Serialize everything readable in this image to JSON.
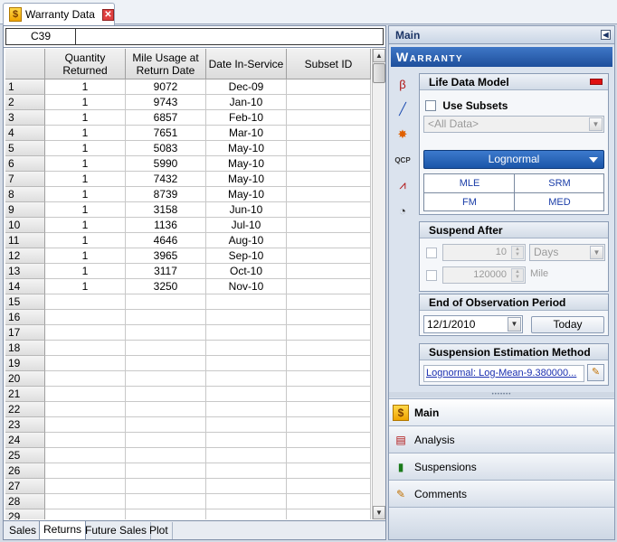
{
  "doc_tab": {
    "title": "Warranty Data",
    "icon": "dollar-icon",
    "close": "✕"
  },
  "formula": {
    "cell_ref": "C39",
    "value": ""
  },
  "columns": [
    {
      "label": "Quantity Returned"
    },
    {
      "label": "Mile Usage at Return Date"
    },
    {
      "label": "Date In-Service"
    },
    {
      "label": "Subset ID"
    }
  ],
  "rows": [
    {
      "n": "1",
      "q": "1",
      "m": "9072",
      "d": "Dec-09",
      "s": ""
    },
    {
      "n": "2",
      "q": "1",
      "m": "9743",
      "d": "Jan-10",
      "s": ""
    },
    {
      "n": "3",
      "q": "1",
      "m": "6857",
      "d": "Feb-10",
      "s": ""
    },
    {
      "n": "4",
      "q": "1",
      "m": "7651",
      "d": "Mar-10",
      "s": ""
    },
    {
      "n": "5",
      "q": "1",
      "m": "5083",
      "d": "May-10",
      "s": ""
    },
    {
      "n": "6",
      "q": "1",
      "m": "5990",
      "d": "May-10",
      "s": ""
    },
    {
      "n": "7",
      "q": "1",
      "m": "7432",
      "d": "May-10",
      "s": ""
    },
    {
      "n": "8",
      "q": "1",
      "m": "8739",
      "d": "May-10",
      "s": ""
    },
    {
      "n": "9",
      "q": "1",
      "m": "3158",
      "d": "Jun-10",
      "s": ""
    },
    {
      "n": "10",
      "q": "1",
      "m": "1136",
      "d": "Jul-10",
      "s": ""
    },
    {
      "n": "11",
      "q": "1",
      "m": "4646",
      "d": "Aug-10",
      "s": ""
    },
    {
      "n": "12",
      "q": "1",
      "m": "3965",
      "d": "Sep-10",
      "s": ""
    },
    {
      "n": "13",
      "q": "1",
      "m": "3117",
      "d": "Oct-10",
      "s": ""
    },
    {
      "n": "14",
      "q": "1",
      "m": "3250",
      "d": "Nov-10",
      "s": ""
    },
    {
      "n": "15",
      "q": "",
      "m": "",
      "d": "",
      "s": ""
    },
    {
      "n": "16",
      "q": "",
      "m": "",
      "d": "",
      "s": ""
    },
    {
      "n": "17",
      "q": "",
      "m": "",
      "d": "",
      "s": ""
    },
    {
      "n": "18",
      "q": "",
      "m": "",
      "d": "",
      "s": ""
    },
    {
      "n": "19",
      "q": "",
      "m": "",
      "d": "",
      "s": ""
    },
    {
      "n": "20",
      "q": "",
      "m": "",
      "d": "",
      "s": ""
    },
    {
      "n": "21",
      "q": "",
      "m": "",
      "d": "",
      "s": ""
    },
    {
      "n": "22",
      "q": "",
      "m": "",
      "d": "",
      "s": ""
    },
    {
      "n": "23",
      "q": "",
      "m": "",
      "d": "",
      "s": ""
    },
    {
      "n": "24",
      "q": "",
      "m": "",
      "d": "",
      "s": ""
    },
    {
      "n": "25",
      "q": "",
      "m": "",
      "d": "",
      "s": ""
    },
    {
      "n": "26",
      "q": "",
      "m": "",
      "d": "",
      "s": ""
    },
    {
      "n": "27",
      "q": "",
      "m": "",
      "d": "",
      "s": ""
    },
    {
      "n": "28",
      "q": "",
      "m": "",
      "d": "",
      "s": ""
    },
    {
      "n": "29",
      "q": "",
      "m": "",
      "d": "",
      "s": ""
    }
  ],
  "sheet_tabs": [
    {
      "label": "Sales",
      "active": false
    },
    {
      "label": "Returns",
      "active": true
    },
    {
      "label": "Future Sales",
      "active": false
    },
    {
      "label": "Plot",
      "active": false
    }
  ],
  "panel": {
    "header": "Main",
    "banner": "Warranty",
    "tools": [
      "beta-icon",
      "line-fit-icon",
      "wizard-icon",
      "qcp-icon",
      "plot-icon",
      "gauge-icon"
    ],
    "tool_glyphs": [
      "β",
      "╱",
      "✸",
      "QCP",
      "⩘",
      "◔"
    ],
    "life_data_model": {
      "title": "Life Data Model",
      "use_subsets_label": "Use Subsets",
      "subset_combo": "<All Data>",
      "distribution": "Lognormal",
      "methods": [
        "MLE",
        "SRM",
        "FM",
        "MED"
      ]
    },
    "suspend_after": {
      "title": "Suspend After",
      "days_value": "10",
      "days_unit": "Days",
      "mile_value": "120000",
      "mile_unit": "Mile"
    },
    "observation": {
      "title": "End of Observation Period",
      "date": "12/1/2010",
      "today_label": "Today"
    },
    "suspension_estimation": {
      "title": "Suspension Estimation Method",
      "link_text": "Lognormal: Log-Mean-9.380000..."
    },
    "nav": [
      {
        "label": "Main",
        "icon": "dollar-icon",
        "glyph": "$",
        "active": true
      },
      {
        "label": "Analysis",
        "icon": "analysis-icon",
        "glyph": "▤",
        "active": false
      },
      {
        "label": "Suspensions",
        "icon": "suspensions-icon",
        "glyph": "▮",
        "active": false
      },
      {
        "label": "Comments",
        "icon": "comments-icon",
        "glyph": "✎",
        "active": false
      }
    ]
  }
}
